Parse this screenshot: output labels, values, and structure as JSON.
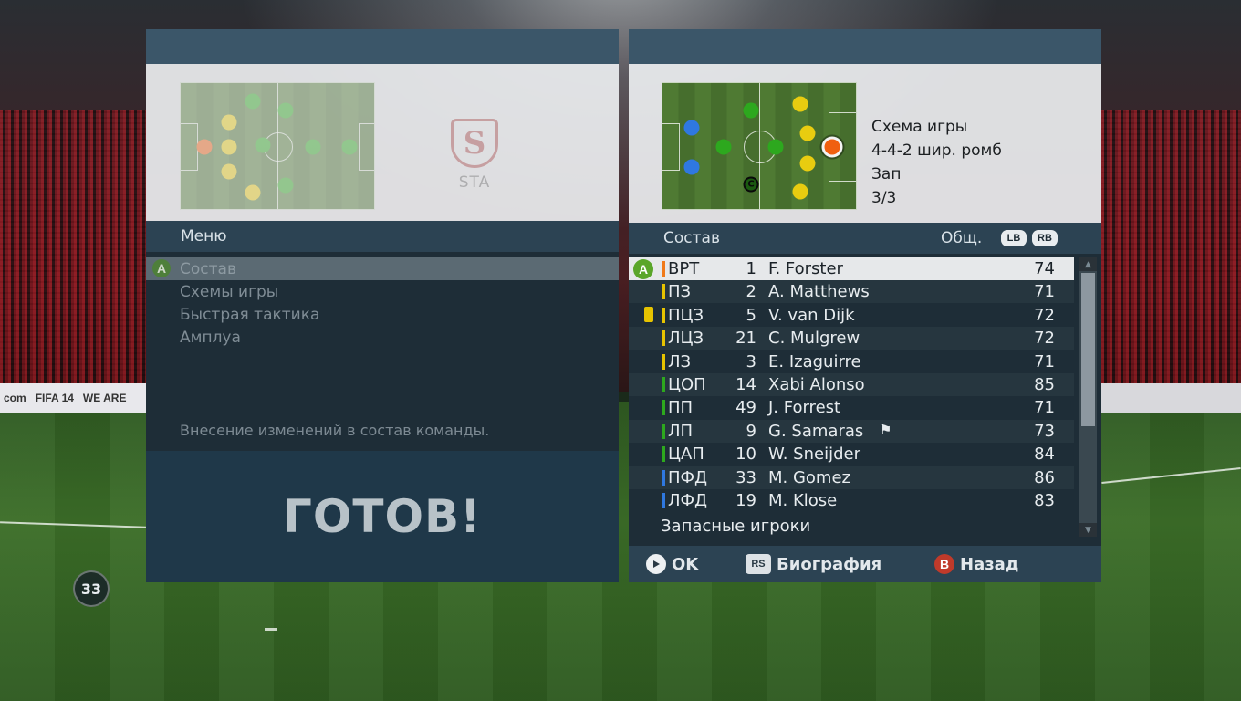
{
  "left_panel": {
    "crest_text": "STA",
    "menu_title": "Меню",
    "menu_items": [
      {
        "label": "Состав",
        "selected": true
      },
      {
        "label": "Схемы игры",
        "selected": false
      },
      {
        "label": "Быстрая тактика",
        "selected": false
      },
      {
        "label": "Амплуа",
        "selected": false
      }
    ],
    "description": "Внесение изменений в состав команды.",
    "ready_label": "ГОТОВ!"
  },
  "right_panel": {
    "formation_heading": "Схема игры",
    "formation_name": "4-4-2 шир. ромб",
    "style": "Зап",
    "count": "3/3",
    "roster_title": "Состав",
    "sort_label": "Общ.",
    "lb_label": "LB",
    "rb_label": "RB",
    "roster": [
      {
        "pos": "ВРТ",
        "num": "1",
        "name": "F. Forster",
        "ovr": "74",
        "bar": "#f07a1a"
      },
      {
        "pos": "ПЗ",
        "num": "2",
        "name": "A. Matthews",
        "ovr": "71",
        "bar": "#e6c300"
      },
      {
        "pos": "ПЦЗ",
        "num": "5",
        "name": "V. van Dijk",
        "ovr": "72",
        "bar": "#e6c300"
      },
      {
        "pos": "ЛЦЗ",
        "num": "21",
        "name": "C. Mulgrew",
        "ovr": "72",
        "bar": "#e6c300"
      },
      {
        "pos": "ЛЗ",
        "num": "3",
        "name": "E. Izaguirre",
        "ovr": "71",
        "bar": "#e6c300"
      },
      {
        "pos": "ЦОП",
        "num": "14",
        "name": "Xabi Alonso",
        "ovr": "85",
        "bar": "#2da81e"
      },
      {
        "pos": "ПП",
        "num": "49",
        "name": "J. Forrest",
        "ovr": "71",
        "bar": "#2da81e"
      },
      {
        "pos": "ЛП",
        "num": "9",
        "name": "G. Samaras",
        "ovr": "73",
        "bar": "#2da81e"
      },
      {
        "pos": "ЦАП",
        "num": "10",
        "name": "W. Sneijder",
        "ovr": "84",
        "bar": "#2da81e"
      },
      {
        "pos": "ПФД",
        "num": "33",
        "name": "M. Gomez",
        "ovr": "86",
        "bar": "#2f78e0"
      },
      {
        "pos": "ЛФД",
        "num": "19",
        "name": "M. Klose",
        "ovr": "83",
        "bar": "#2f78e0"
      }
    ],
    "subs_label": "Запасные игроки",
    "captain_mark": "C",
    "footer": {
      "ok": "OK",
      "bio": "Биография",
      "back": "Назад",
      "rs": "RS",
      "b": "B"
    }
  },
  "button_a": "A",
  "timer": "33",
  "ads": {
    "left_1": "FIFA 14",
    "left_2": "WE ARE",
    "left_3": "com"
  }
}
